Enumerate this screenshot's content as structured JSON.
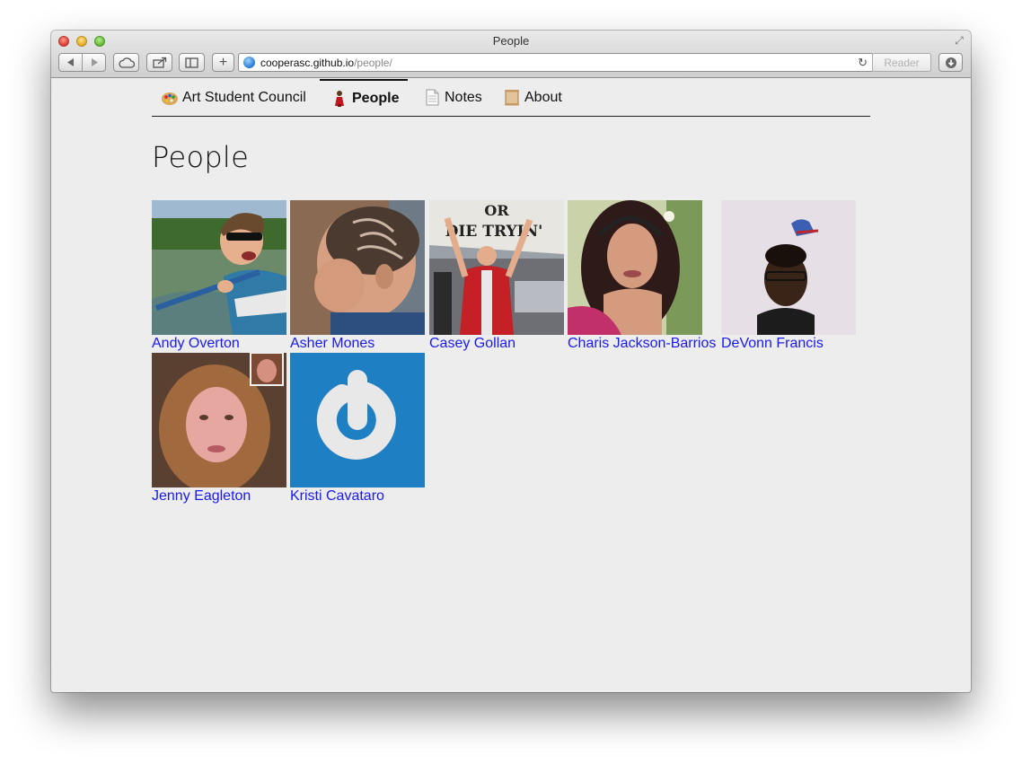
{
  "browser": {
    "window_title": "People",
    "url_host": "cooperasc.github.io",
    "url_path": "/people/",
    "reader_label": "Reader"
  },
  "nav": {
    "items": [
      {
        "label": "Art Student Council",
        "icon": "palette-icon"
      },
      {
        "label": "People",
        "icon": "person-icon",
        "active": true
      },
      {
        "label": "Notes",
        "icon": "document-icon"
      },
      {
        "label": "About",
        "icon": "scroll-icon"
      }
    ]
  },
  "page": {
    "title": "People"
  },
  "people": [
    {
      "name": "Andy Overton"
    },
    {
      "name": "Asher Mones"
    },
    {
      "name": "Casey Gollan"
    },
    {
      "name": "Charis Jackson-Barrios"
    },
    {
      "name": "DeVonn Francis"
    },
    {
      "name": "Jenny Eagleton"
    },
    {
      "name": "Kristi Cavataro"
    }
  ],
  "photo_signs": {
    "casey_sign_line1": "OR",
    "casey_sign_line2": "DIE TRYIN'"
  },
  "colors": {
    "link": "#1a1aee",
    "page_bg": "#ededed",
    "gravatar_blue": "#1e7fc2"
  }
}
